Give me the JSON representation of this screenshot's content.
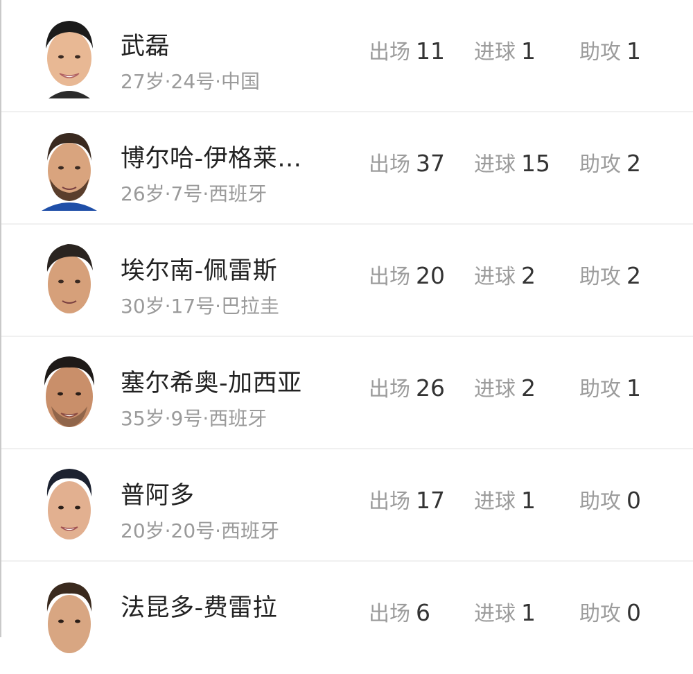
{
  "players": [
    {
      "name": "武磊",
      "meta": "27岁·24号·中国",
      "appearances_label": "出场",
      "appearances": "11",
      "goals_label": "进球",
      "goals": "1",
      "assists_label": "助攻",
      "assists": "1",
      "shirt_color": "#2b2b2b"
    },
    {
      "name": "博尔哈-伊格莱…",
      "meta": "26岁·7号·西班牙",
      "appearances_label": "出场",
      "appearances": "37",
      "goals_label": "进球",
      "goals": "15",
      "assists_label": "助攻",
      "assists": "2",
      "shirt_color": "#1f4fa8"
    },
    {
      "name": "埃尔南-佩雷斯",
      "meta": "30岁·17号·巴拉圭",
      "appearances_label": "出场",
      "appearances": "20",
      "goals_label": "进球",
      "goals": "2",
      "assists_label": "助攻",
      "assists": "2",
      "shirt_color": "#d9d9d9"
    },
    {
      "name": "塞尔希奥-加西亚",
      "meta": "35岁·9号·西班牙",
      "appearances_label": "出场",
      "appearances": "26",
      "goals_label": "进球",
      "goals": "2",
      "assists_label": "助攻",
      "assists": "1",
      "shirt_color": "#d9d9d9"
    },
    {
      "name": "普阿多",
      "meta": "20岁·20号·西班牙",
      "appearances_label": "出场",
      "appearances": "17",
      "goals_label": "进球",
      "goals": "1",
      "assists_label": "助攻",
      "assists": "0",
      "shirt_color": "#d9d9d9"
    },
    {
      "name": "法昆多-费雷拉",
      "meta": "",
      "appearances_label": "出场",
      "appearances": "6",
      "goals_label": "进球",
      "goals": "1",
      "assists_label": "助攻",
      "assists": "0",
      "shirt_color": "#d9d9d9"
    }
  ],
  "colors": {
    "name": "#222222",
    "meta": "#9a9a9a",
    "label": "#9c9c9c",
    "value": "#333333",
    "divider": "#f0f0f0"
  },
  "icons": {
    "avatar": "player-avatar-icon"
  }
}
